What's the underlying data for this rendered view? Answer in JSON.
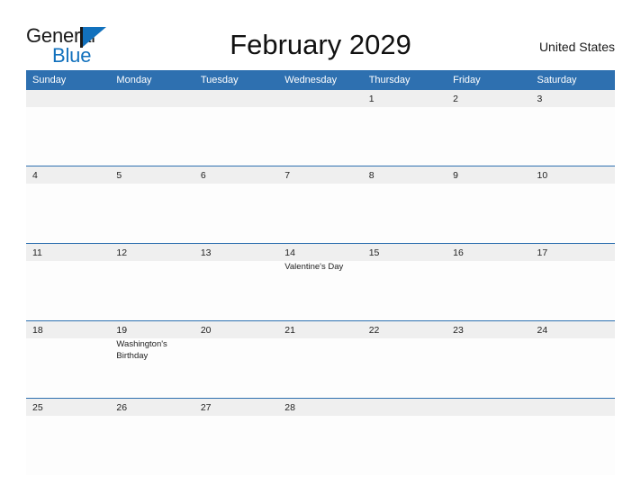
{
  "brand": {
    "name_part1": "General",
    "name_part2": "Blue",
    "flag_icon": "blue-flag-triangle-icon",
    "accent_color": "#1271bd"
  },
  "header": {
    "title": "February 2029",
    "region": "United States"
  },
  "calendar": {
    "month": "February",
    "year": "2029",
    "header_bg_color": "#2e70b0",
    "daynum_bg_color": "#efefef",
    "weekday_headers": [
      "Sunday",
      "Monday",
      "Tuesday",
      "Wednesday",
      "Thursday",
      "Friday",
      "Saturday"
    ],
    "weeks": [
      {
        "days": [
          {
            "num": "",
            "event": ""
          },
          {
            "num": "",
            "event": ""
          },
          {
            "num": "",
            "event": ""
          },
          {
            "num": "",
            "event": ""
          },
          {
            "num": "1",
            "event": ""
          },
          {
            "num": "2",
            "event": ""
          },
          {
            "num": "3",
            "event": ""
          }
        ]
      },
      {
        "days": [
          {
            "num": "4",
            "event": ""
          },
          {
            "num": "5",
            "event": ""
          },
          {
            "num": "6",
            "event": ""
          },
          {
            "num": "7",
            "event": ""
          },
          {
            "num": "8",
            "event": ""
          },
          {
            "num": "9",
            "event": ""
          },
          {
            "num": "10",
            "event": ""
          }
        ]
      },
      {
        "days": [
          {
            "num": "11",
            "event": ""
          },
          {
            "num": "12",
            "event": ""
          },
          {
            "num": "13",
            "event": ""
          },
          {
            "num": "14",
            "event": "Valentine's Day"
          },
          {
            "num": "15",
            "event": ""
          },
          {
            "num": "16",
            "event": ""
          },
          {
            "num": "17",
            "event": ""
          }
        ]
      },
      {
        "days": [
          {
            "num": "18",
            "event": ""
          },
          {
            "num": "19",
            "event": "Washington's Birthday"
          },
          {
            "num": "20",
            "event": ""
          },
          {
            "num": "21",
            "event": ""
          },
          {
            "num": "22",
            "event": ""
          },
          {
            "num": "23",
            "event": ""
          },
          {
            "num": "24",
            "event": ""
          }
        ]
      },
      {
        "days": [
          {
            "num": "25",
            "event": ""
          },
          {
            "num": "26",
            "event": ""
          },
          {
            "num": "27",
            "event": ""
          },
          {
            "num": "28",
            "event": ""
          },
          {
            "num": "",
            "event": ""
          },
          {
            "num": "",
            "event": ""
          },
          {
            "num": "",
            "event": ""
          }
        ]
      }
    ]
  }
}
